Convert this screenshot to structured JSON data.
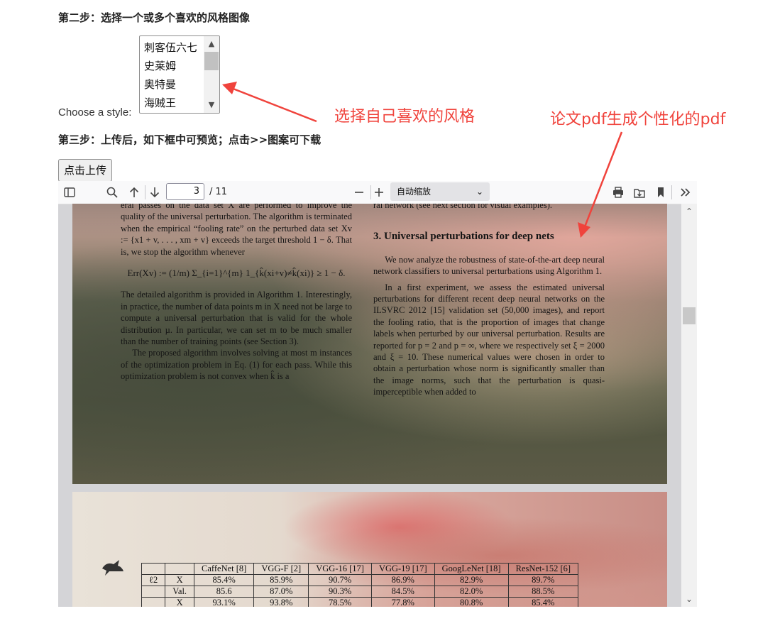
{
  "step2_title": "第二步：选择一个或多个喜欢的风格图像",
  "style_label": "Choose a style:",
  "style_options": [
    "刺客伍六七",
    "史莱姆",
    "奥特曼",
    "海贼王"
  ],
  "step3_title": "第三步：上传后，如下框中可预览；点击>>图案可下载",
  "upload_button": "点击上传",
  "annotations": {
    "select_style": "选择自己喜欢的风格",
    "pdf_generate": "论文pdf生成个性化的pdf",
    "color": "#f0433c"
  },
  "pdf_viewer": {
    "current_page": "3",
    "page_count": "/ 11",
    "zoom": "自动缩放",
    "icons": [
      "sidebar-toggle-icon",
      "search-icon",
      "arrow-up-icon",
      "arrow-down-icon",
      "minus-icon",
      "plus-icon",
      "print-icon",
      "download-icon",
      "bookmark-icon",
      "more-tools-icon"
    ]
  },
  "page3": {
    "left_col": {
      "p1": "eral passes on the data set X are performed to improve the quality of the universal perturbation. The algorithm is terminated when the empirical “fooling rate” on the perturbed data set Xv := {x1 + v, . . . , xm + v} exceeds the target threshold 1 − δ. That is, we stop the algorithm whenever",
      "equation": "Err(Xv) := (1/m) Σ_{i=1}^{m} 1_{k̂(xi+v)≠k̂(xi)} ≥ 1 − δ.",
      "p2": "The detailed algorithm is provided in Algorithm 1. Interestingly, in practice, the number of data points m in X need not be large to compute a universal perturbation that is valid for the whole distribution µ. In particular, we can set m to be much smaller than the number of training points (see Section 3).",
      "p3": "The proposed algorithm involves solving at most m instances of the optimization problem in Eq. (1) for each pass. While this optimization problem is not convex when k̂ is a"
    },
    "right_col": {
      "p0": "ral network (see next section for visual examples).",
      "heading": "3. Universal perturbations for deep nets",
      "p1": "We now analyze the robustness of state-of-the-art deep neural network classifiers to universal perturbations using Algorithm 1.",
      "p2": "In a first experiment, we assess the estimated universal perturbations for different recent deep neural networks on the ILSVRC 2012 [15] validation set (50,000 images), and report the fooling ratio, that is the proportion of images that change labels when perturbed by our universal perturbation. Results are reported for p = 2 and p = ∞, where we respectively set ξ = 2000 and ξ = 10. These numerical values were chosen in order to obtain a perturbation whose norm is significantly smaller than the image norms, such that the perturbation is quasi-imperceptible when added to"
    }
  },
  "page4_table": {
    "headers": [
      "",
      "",
      "CaffeNet [8]",
      "VGG-F [2]",
      "VGG-16 [17]",
      "VGG-19 [17]",
      "GoogLeNet [18]",
      "ResNet-152 [6]"
    ],
    "rows": [
      [
        "ℓ2",
        "X",
        "85.4%",
        "85.9%",
        "90.7%",
        "86.9%",
        "82.9%",
        "89.7%"
      ],
      [
        "",
        "Val.",
        "85.6",
        "87.0%",
        "90.3%",
        "84.5%",
        "82.0%",
        "88.5%"
      ],
      [
        "",
        "X",
        "93.1%",
        "93.8%",
        "78.5%",
        "77.8%",
        "80.8%",
        "85.4%"
      ]
    ]
  }
}
